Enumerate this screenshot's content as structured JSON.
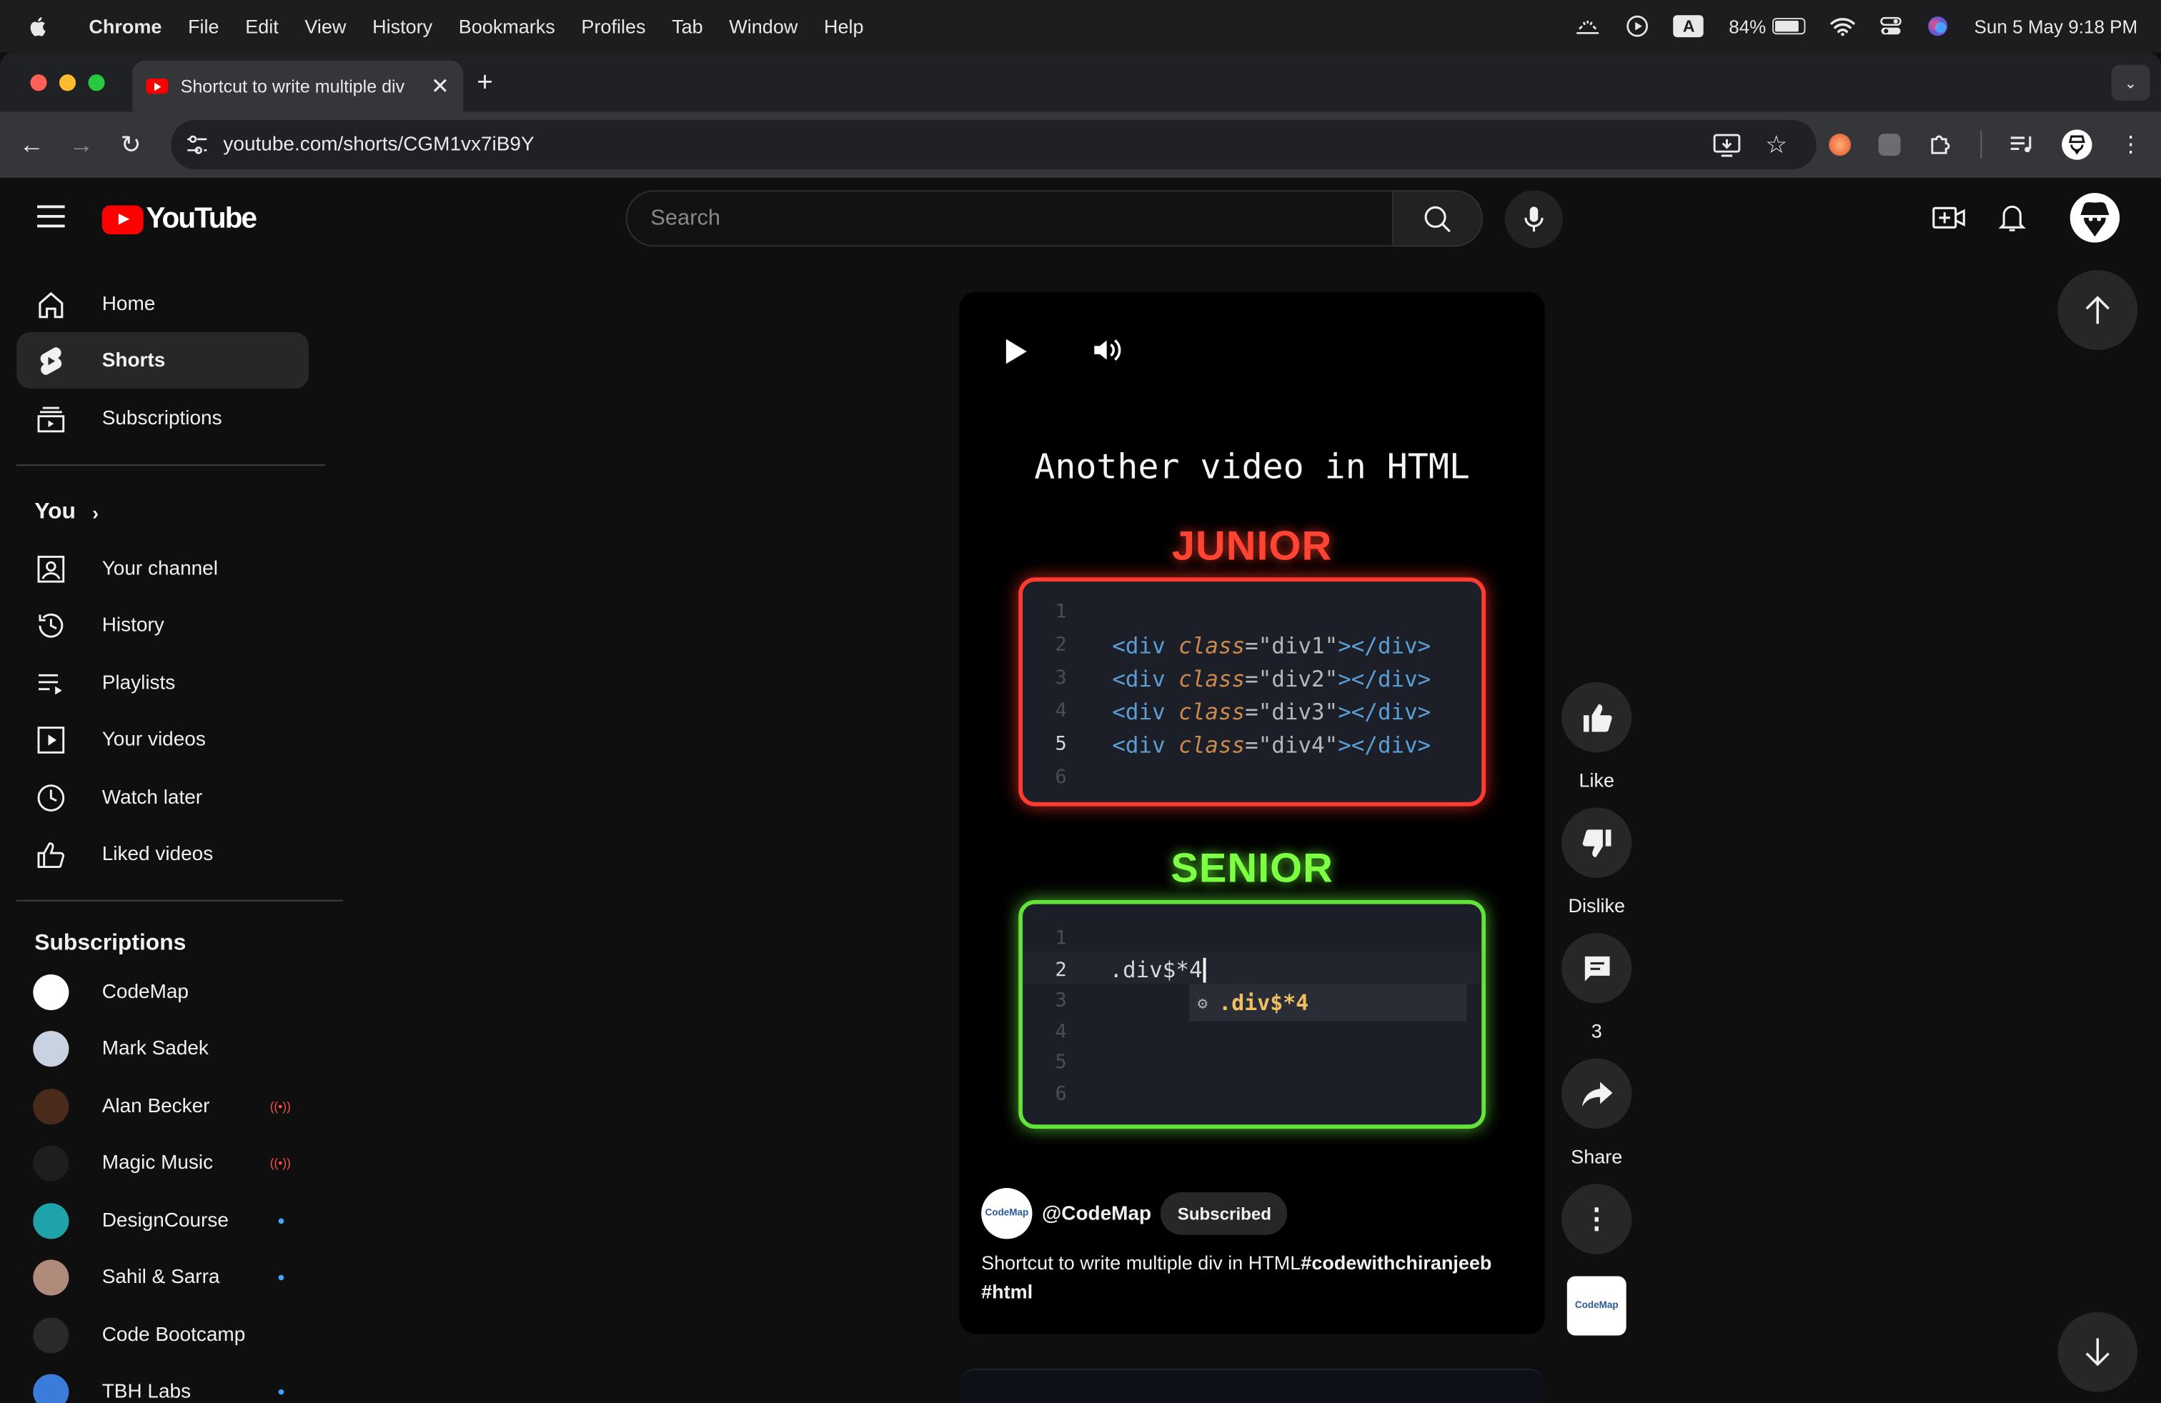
{
  "menubar": {
    "app": "Chrome",
    "menus": [
      "File",
      "Edit",
      "View",
      "History",
      "Bookmarks",
      "Profiles",
      "Tab",
      "Window",
      "Help"
    ],
    "keyboard": "A",
    "battery": "84%",
    "battery_level": 0.84,
    "datetime": "Sun 5 May  9:18 PM"
  },
  "browser": {
    "tab_title": "Shortcut to write multiple div",
    "url": "youtube.com/shorts/CGM1vx7iB9Y"
  },
  "header": {
    "logo_text": "YouTube",
    "search_placeholder": "Search"
  },
  "sidebar": {
    "main": [
      {
        "label": "Home",
        "icon": "home-icon"
      },
      {
        "label": "Shorts",
        "icon": "shorts-icon",
        "active": true
      },
      {
        "label": "Subscriptions",
        "icon": "subscriptions-icon"
      }
    ],
    "you_label": "You",
    "you": [
      {
        "label": "Your channel",
        "icon": "channel-icon"
      },
      {
        "label": "History",
        "icon": "history-icon"
      },
      {
        "label": "Playlists",
        "icon": "playlists-icon"
      },
      {
        "label": "Your videos",
        "icon": "videos-icon"
      },
      {
        "label": "Watch later",
        "icon": "watch-later-icon"
      },
      {
        "label": "Liked videos",
        "icon": "liked-icon"
      }
    ],
    "subscriptions_label": "Subscriptions",
    "subscriptions": [
      {
        "name": "CodeMap",
        "status": "",
        "color": "#ffffff"
      },
      {
        "name": "Mark Sadek",
        "status": "",
        "color": "#c9d2e0"
      },
      {
        "name": "Alan Becker",
        "status": "live",
        "color": "#4a2a1a"
      },
      {
        "name": "Magic Music",
        "status": "live",
        "color": "#1e1e1e"
      },
      {
        "name": "DesignCourse",
        "status": "new",
        "color": "#1fa3a8"
      },
      {
        "name": "Sahil & Sarra",
        "status": "new",
        "color": "#b08a7a"
      },
      {
        "name": "Code Bootcamp",
        "status": "",
        "color": "#2a2a2a"
      },
      {
        "name": "TBH Labs",
        "status": "new",
        "color": "#3b7bd9"
      }
    ],
    "live_glyph": "((•))"
  },
  "video": {
    "heading": "Another video in HTML",
    "junior_label": "JUNIOR",
    "senior_label": "SENIOR",
    "junior_lines": [
      {
        "n": "1",
        "code": null
      },
      {
        "n": "2",
        "cls": "div1"
      },
      {
        "n": "3",
        "cls": "div2"
      },
      {
        "n": "4",
        "cls": "div3"
      },
      {
        "n": "5",
        "cls": "div4",
        "current": true
      },
      {
        "n": "6",
        "code": null
      }
    ],
    "senior_lines": [
      {
        "n": "1",
        "text": ""
      },
      {
        "n": "2",
        "text": ".div$*4",
        "current": true
      },
      {
        "n": "3",
        "text": ""
      },
      {
        "n": "4",
        "text": ""
      },
      {
        "n": "5",
        "text": ""
      },
      {
        "n": "6",
        "text": ""
      }
    ],
    "suggestion": ".div$*4",
    "channel_handle": "@CodeMap",
    "subscribe_label": "Subscribed",
    "title_plain": "Shortcut to write multiple div in HTML",
    "title_tag1": "#codewithchiranjeeb",
    "title_tag2": "#html",
    "avatar_text": "CodeMap"
  },
  "actions": {
    "like": "Like",
    "dislike": "Dislike",
    "comments": "3",
    "share": "Share"
  }
}
